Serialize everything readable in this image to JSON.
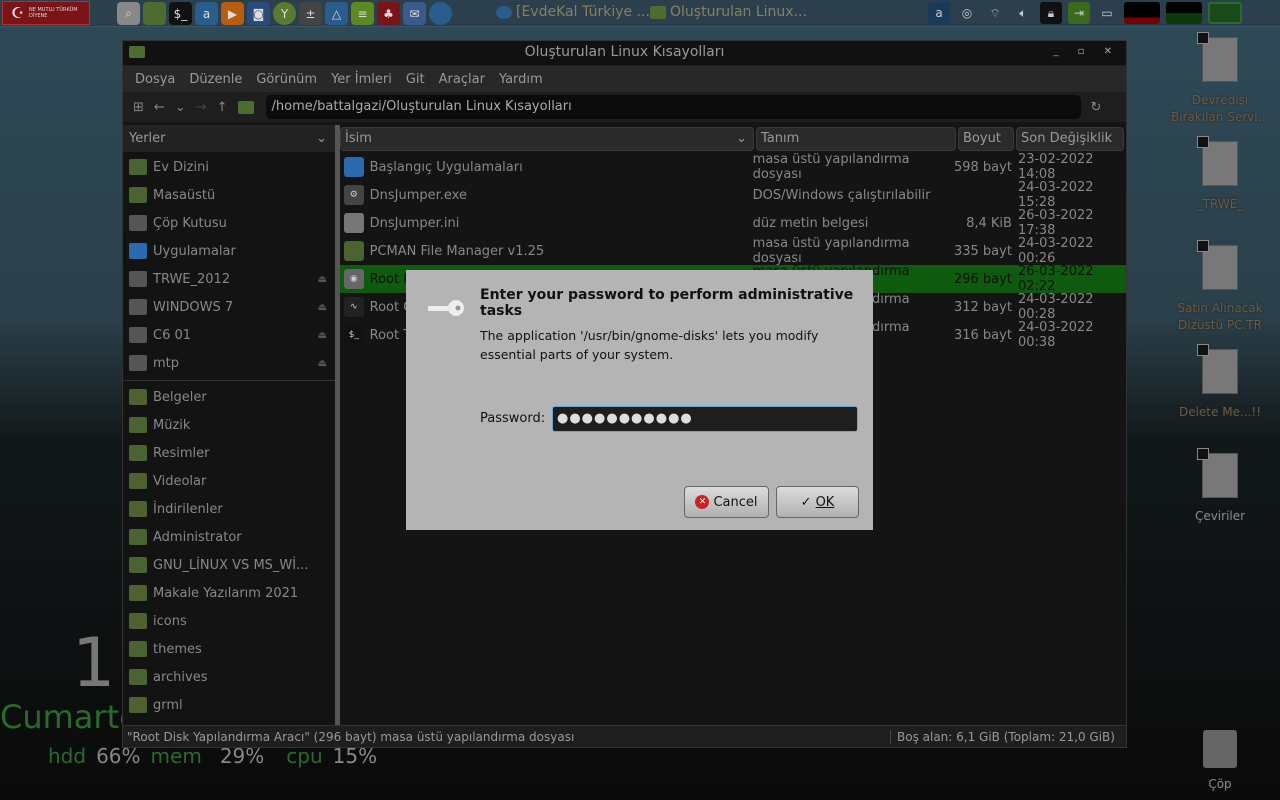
{
  "panel": {
    "flag_text": "NE MUTLU TÜRKÜM DİYENE",
    "launchers": [
      "search-icon",
      "folder-icon",
      "terminal-icon",
      "a-icon",
      "play-icon",
      "camera-icon",
      "key-icon",
      "calculator-icon",
      "delta-icon",
      "notes-icon",
      "cherry-icon",
      "mail-icon",
      "globe-icon"
    ],
    "tasks": [
      {
        "label": "[EvdeKal Türkiye ..."
      },
      {
        "label": "Oluşturulan Linux..."
      }
    ],
    "tray": [
      "a-icon",
      "sync-icon",
      "wifi-icon",
      "volume-icon",
      "lock-icon",
      "exit-icon",
      "window-icon",
      "cpu-graph",
      "net-graph",
      "folder-icon"
    ]
  },
  "window": {
    "title": "Oluşturulan Linux Kısayolları",
    "menu": [
      "Dosya",
      "Düzenle",
      "Görünüm",
      "Yer İmleri",
      "Git",
      "Araçlar",
      "Yardım"
    ],
    "path": "/home/battalgazi/Oluşturulan Linux Kısayolları",
    "sidebar": {
      "header": "Yerler",
      "items": [
        "Ev Dizini",
        "Masaüstü",
        "Çöp Kutusu",
        "Uygulamalar",
        "TRWE_2012",
        "WINDOWS 7",
        "C6 01",
        "mtp"
      ],
      "bookmarks": [
        "Belgeler",
        "Müzik",
        "Resimler",
        "Videolar",
        "İndirilenler",
        "Administrator",
        "GNU_LİNUX VS MS_Wİ...",
        "Makale Yazılarım 2021",
        "icons",
        "themes",
        "archives",
        "grml"
      ]
    },
    "columns": [
      "İsim",
      "Tanım",
      "Boyut",
      "Son Değişiklik"
    ],
    "files": [
      {
        "name": "Başlangıç Uygulamaları",
        "desc": "masa üstü yapılandırma dosyası",
        "size": "598 bayt",
        "modified": "23-02-2022 14:08"
      },
      {
        "name": "DnsJumper.exe",
        "desc": "DOS/Windows çalıştırılabilir",
        "size": "",
        "modified": "24-03-2022 15:28"
      },
      {
        "name": "DnsJumper.ini",
        "desc": "düz metin belgesi",
        "size": "8,4 KiB",
        "modified": "26-03-2022 17:38"
      },
      {
        "name": "PCMAN File Manager v1.25",
        "desc": "masa üstü yapılandırma dosyası",
        "size": "335 bayt",
        "modified": "24-03-2022 00:26"
      },
      {
        "name": "Root Disk Yapılandırma Aracı",
        "desc": "masa üstü yapılandırma dosyası",
        "size": "296 bayt",
        "modified": "26-03-2022 02:22"
      },
      {
        "name": "Root C",
        "desc": "masa üstü yapılandırma dosyası",
        "size": "312 bayt",
        "modified": "24-03-2022 00:28"
      },
      {
        "name": "Root T",
        "desc": "masa üstü yapılandırma dosyası",
        "size": "316 bayt",
        "modified": "24-03-2022 00:38"
      }
    ],
    "status_left": "\"Root Disk Yapılandırma Aracı\" (296 bayt) masa üstü yapılandırma dosyası",
    "status_right": "Boş alan: 6,1 GiB (Toplam: 21,0 GiB)"
  },
  "dialog": {
    "title": "Enter your password to perform administrative tasks",
    "message": "The application '/usr/bin/gnome-disks' lets you modify essential parts of your system.",
    "password_label": "Password:",
    "password_value": "●●●●●●●●●●●",
    "cancel": "Cancel",
    "ok": "OK"
  },
  "desktop": {
    "icons": [
      "Devredışı Bırakılan Servi...",
      "_TRWE_",
      "Satın Alınacak Dizüstü PC.TR",
      "Delete Me...!!",
      "Çeviriler"
    ],
    "trash": "Çöp"
  },
  "conky": {
    "clock": "1",
    "day": "Cumarte",
    "hdd_label": "hdd",
    "hdd": "66%",
    "mem_label": "mem",
    "mem": "29%",
    "cpu_label": "cpu",
    "cpu": "15%"
  }
}
